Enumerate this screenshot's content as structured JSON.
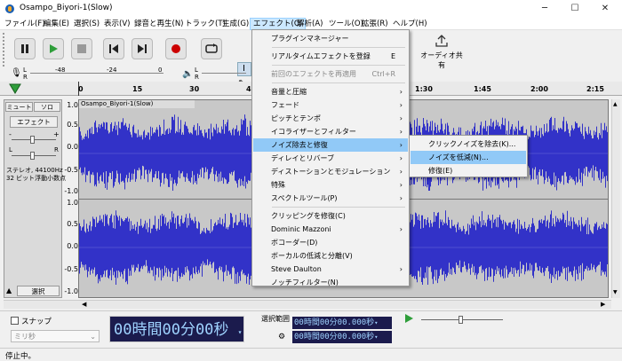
{
  "window": {
    "title": "Osampo_Biyori-1(Slow)",
    "controls": [
      "─",
      "☐",
      "✕"
    ]
  },
  "menubar": [
    "ファイル(F)",
    "編集(E)",
    "選択(S)",
    "表示(V)",
    "録音と再生(N)",
    "トラック(T)",
    "生成(G)",
    "エフェクト(C)",
    "解析(A)",
    "ツール(O)",
    "拡張(R)",
    "ヘルプ(H)"
  ],
  "toolbar": {
    "share_label": "オーディオ共有",
    "meter_ticks": [
      "-48",
      "-24",
      "0"
    ],
    "meter_left": "L",
    "meter_right": "R"
  },
  "ruler": {
    "ticks": [
      "0",
      "15",
      "30",
      "4",
      "1:30",
      "1:45",
      "2:00",
      "2:15"
    ]
  },
  "track": {
    "name": "Osampo_Biyori-1(Slow)",
    "mute": "ミュート",
    "solo": "ソロ",
    "effect": "エフェクト",
    "gain_minus": "-",
    "gain_plus": "+",
    "pan_l": "L",
    "pan_r": "R",
    "info1": "ステレオ, 44100Hz",
    "info2": "32 ビット浮動小数点",
    "select": "選択",
    "scale": [
      "1.0",
      "0.5",
      "0.0",
      "-0.5",
      "-1.0",
      "1.0",
      "0.5",
      "0.0",
      "-0.5",
      "-1.0"
    ]
  },
  "bottom": {
    "snap": "スナップ",
    "snap_unit": "ミリ秒",
    "time": "00時間00分00秒",
    "selection_label": "選択範囲",
    "sel_start": "00時間00分00.000秒",
    "sel_end": "00時間00分00.000秒"
  },
  "status": "停止中。",
  "effect_menu": {
    "items": [
      {
        "label": "プラグインマネージャー",
        "shortcut": "",
        "arrow": false,
        "disabled": false,
        "highlight": false
      },
      {
        "sep": true
      },
      {
        "label": "リアルタイムエフェクトを登録",
        "shortcut": "E",
        "arrow": false,
        "disabled": false,
        "highlight": false
      },
      {
        "sep": true
      },
      {
        "label": "前回のエフェクトを再適用",
        "shortcut": "Ctrl+R",
        "arrow": false,
        "disabled": true,
        "highlight": false
      },
      {
        "sep": true
      },
      {
        "label": "音量と圧縮",
        "shortcut": "",
        "arrow": true,
        "disabled": false,
        "highlight": false
      },
      {
        "label": "フェード",
        "shortcut": "",
        "arrow": true,
        "disabled": false,
        "highlight": false
      },
      {
        "label": "ピッチとテンポ",
        "shortcut": "",
        "arrow": true,
        "disabled": false,
        "highlight": false
      },
      {
        "label": "イコライザーとフィルター",
        "shortcut": "",
        "arrow": true,
        "disabled": false,
        "highlight": false
      },
      {
        "label": "ノイズ除去と修復",
        "shortcut": "",
        "arrow": true,
        "disabled": false,
        "highlight": true
      },
      {
        "label": "ディレイとリバーブ",
        "shortcut": "",
        "arrow": true,
        "disabled": false,
        "highlight": false
      },
      {
        "label": "ディストーションとモジュレーション",
        "shortcut": "",
        "arrow": true,
        "disabled": false,
        "highlight": false
      },
      {
        "label": "特殊",
        "shortcut": "",
        "arrow": true,
        "disabled": false,
        "highlight": false
      },
      {
        "label": "スペクトルツール(P)",
        "shortcut": "",
        "arrow": true,
        "disabled": false,
        "highlight": false
      },
      {
        "sep": true
      },
      {
        "label": "クリッピングを修復(C)",
        "shortcut": "",
        "arrow": false,
        "disabled": false,
        "highlight": false
      },
      {
        "label": "Dominic Mazzoni",
        "shortcut": "",
        "arrow": true,
        "disabled": false,
        "highlight": false
      },
      {
        "label": "ボコーダー(D)",
        "shortcut": "",
        "arrow": false,
        "disabled": false,
        "highlight": false
      },
      {
        "label": "ボーカルの低減と分離(V)",
        "shortcut": "",
        "arrow": false,
        "disabled": false,
        "highlight": false
      },
      {
        "label": "Steve Daulton",
        "shortcut": "",
        "arrow": true,
        "disabled": false,
        "highlight": false
      },
      {
        "label": "ノッチフィルター(N)",
        "shortcut": "",
        "arrow": false,
        "disabled": false,
        "highlight": false
      }
    ]
  },
  "noise_submenu": {
    "items": [
      {
        "label": "クリックノイズを除去(K)...",
        "highlight": false
      },
      {
        "label": "ノイズを低減(N)...",
        "highlight": true
      },
      {
        "label": "修復(E)",
        "highlight": false
      }
    ]
  },
  "colors": {
    "waveform": "#3232c8",
    "highlight": "#91c9f7",
    "record": "#cc0000",
    "play": "#2e9e3a"
  }
}
